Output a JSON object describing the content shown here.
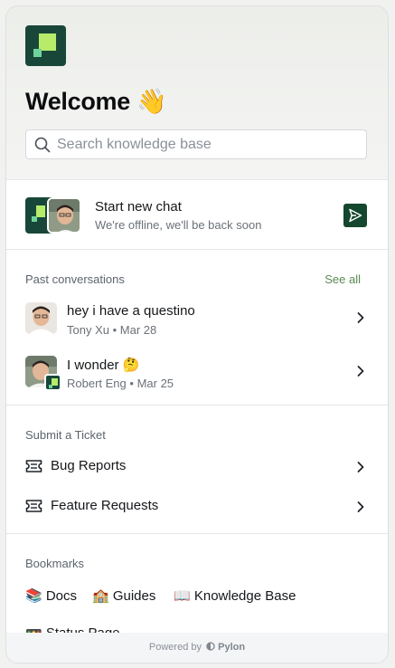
{
  "header": {
    "title": "Welcome 👋",
    "search_placeholder": "Search knowledge base"
  },
  "start_chat": {
    "title": "Start new chat",
    "subtitle": "We're offline, we'll be back soon"
  },
  "past_conversations": {
    "label": "Past conversations",
    "see_all": "See all",
    "items": [
      {
        "message": "hey i have a questino",
        "author": "Tony Xu",
        "date": "Mar 28"
      },
      {
        "message": "I wonder 🤔",
        "author": "Robert Eng",
        "date": "Mar 25"
      }
    ]
  },
  "tickets": {
    "label": "Submit a Ticket",
    "items": [
      {
        "label": "Bug Reports"
      },
      {
        "label": "Feature Requests"
      }
    ]
  },
  "bookmarks": {
    "label": "Bookmarks",
    "items": [
      {
        "label": "📚 Docs"
      },
      {
        "label": "🏫 Guides"
      },
      {
        "label": "📖 Knowledge Base"
      },
      {
        "label": "🚥 Status Page"
      }
    ]
  },
  "footer": {
    "powered_by": "Powered by",
    "brand": "Pylon"
  },
  "colors": {
    "brand_dark": "#18473a",
    "brand_lime": "#b7ec6b",
    "see_all": "#5a8a52"
  }
}
